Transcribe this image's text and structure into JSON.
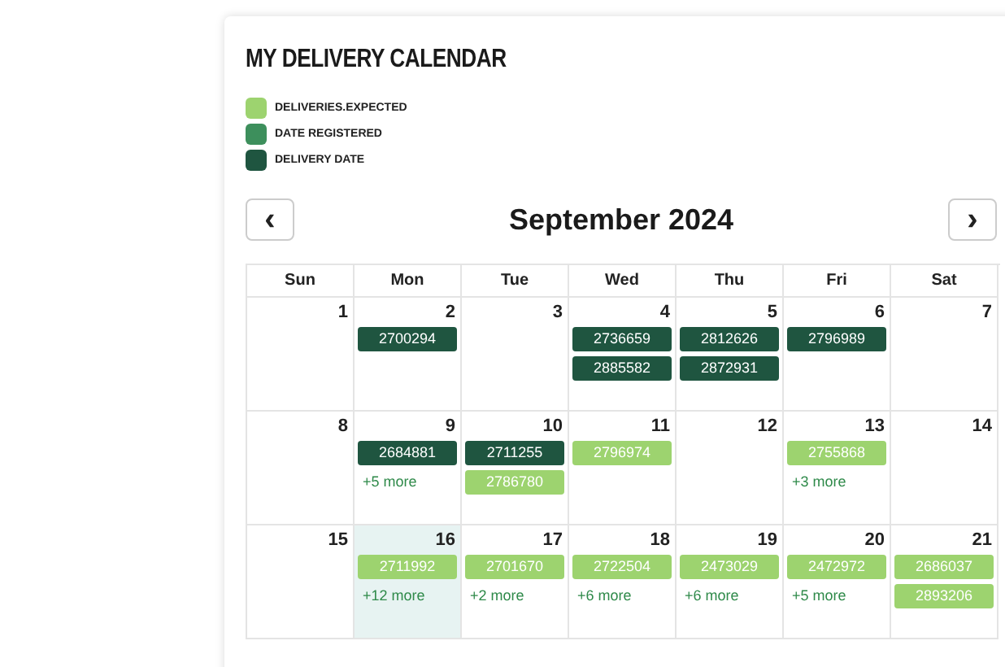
{
  "title": "MY DELIVERY CALENDAR",
  "legend": [
    {
      "kind": "expected",
      "label": "DELIVERIES.EXPECTED",
      "color": "#9dd36f"
    },
    {
      "kind": "registered",
      "label": "DATE REGISTERED",
      "color": "#3d8f5c"
    },
    {
      "kind": "delivery",
      "label": "DELIVERY DATE",
      "color": "#1f5540"
    }
  ],
  "nav": {
    "prev": "‹",
    "month": "September 2024",
    "next": "›"
  },
  "weekdays": [
    "Sun",
    "Mon",
    "Tue",
    "Wed",
    "Thu",
    "Fri",
    "Sat"
  ],
  "weeks": [
    [
      {
        "day": "1",
        "today": false
      },
      {
        "day": "2",
        "today": false,
        "events": [
          {
            "id": "2700294",
            "kind": "delivery"
          }
        ]
      },
      {
        "day": "3",
        "today": false
      },
      {
        "day": "4",
        "today": false,
        "events": [
          {
            "id": "2736659",
            "kind": "delivery"
          },
          {
            "id": "2885582",
            "kind": "delivery"
          }
        ]
      },
      {
        "day": "5",
        "today": false,
        "events": [
          {
            "id": "2812626",
            "kind": "delivery"
          },
          {
            "id": "2872931",
            "kind": "delivery"
          }
        ]
      },
      {
        "day": "6",
        "today": false,
        "events": [
          {
            "id": "2796989",
            "kind": "delivery"
          }
        ]
      },
      {
        "day": "7",
        "today": false
      }
    ],
    [
      {
        "day": "8",
        "today": false
      },
      {
        "day": "9",
        "today": false,
        "events": [
          {
            "id": "2684881",
            "kind": "delivery"
          }
        ],
        "more": "+5 more"
      },
      {
        "day": "10",
        "today": false,
        "events": [
          {
            "id": "2711255",
            "kind": "delivery"
          },
          {
            "id": "2786780",
            "kind": "expected"
          }
        ]
      },
      {
        "day": "11",
        "today": false,
        "events": [
          {
            "id": "2796974",
            "kind": "expected"
          }
        ]
      },
      {
        "day": "12",
        "today": false
      },
      {
        "day": "13",
        "today": false,
        "events": [
          {
            "id": "2755868",
            "kind": "expected"
          }
        ],
        "more": "+3 more"
      },
      {
        "day": "14",
        "today": false
      }
    ],
    [
      {
        "day": "15",
        "today": false
      },
      {
        "day": "16",
        "today": true,
        "events": [
          {
            "id": "2711992",
            "kind": "expected"
          }
        ],
        "more": "+12 more"
      },
      {
        "day": "17",
        "today": false,
        "events": [
          {
            "id": "2701670",
            "kind": "expected"
          }
        ],
        "more": "+2 more"
      },
      {
        "day": "18",
        "today": false,
        "events": [
          {
            "id": "2722504",
            "kind": "expected"
          }
        ],
        "more": "+6 more"
      },
      {
        "day": "19",
        "today": false,
        "events": [
          {
            "id": "2473029",
            "kind": "expected"
          }
        ],
        "more": "+6 more"
      },
      {
        "day": "20",
        "today": false,
        "events": [
          {
            "id": "2472972",
            "kind": "expected"
          }
        ],
        "more": "+5 more"
      },
      {
        "day": "21",
        "today": false,
        "events": [
          {
            "id": "2686037",
            "kind": "expected"
          },
          {
            "id": "2893206",
            "kind": "expected"
          }
        ]
      }
    ]
  ]
}
